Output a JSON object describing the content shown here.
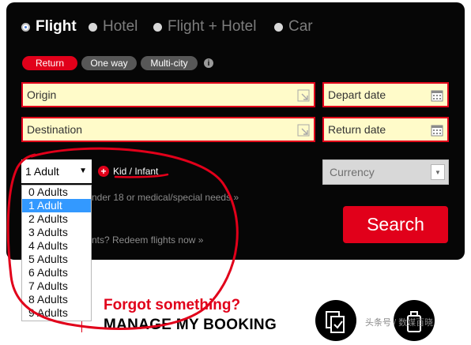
{
  "product_types": [
    {
      "label": "Flight",
      "selected": true
    },
    {
      "label": "Hotel",
      "selected": false
    },
    {
      "label": "Flight + Hotel",
      "selected": false
    },
    {
      "label": "Car",
      "selected": false
    }
  ],
  "trip_types": [
    {
      "label": "Return",
      "selected": true
    },
    {
      "label": "One way",
      "selected": false
    },
    {
      "label": "Multi-city",
      "selected": false
    }
  ],
  "trip_info_icon": "info-icon",
  "fields": {
    "origin_placeholder": "Origin",
    "destination_placeholder": "Destination",
    "depart_placeholder": "Depart date",
    "return_placeholder": "Return date"
  },
  "passengers": {
    "selected": "1 Adult",
    "options": [
      "0 Adults",
      "1 Adult",
      "2 Adults",
      "3 Adults",
      "4 Adults",
      "5 Adults",
      "6 Adults",
      "7 Adults",
      "8 Adults",
      "9 Adults"
    ],
    "highlighted_index": 1
  },
  "kid_label": "Kid / Infant",
  "currency_placeholder": "Currency",
  "note_under18": "nder 18 or medical/special needs »",
  "note_redeem": "nts? Redeem flights now »",
  "search_label": "Search",
  "banner": {
    "title": "Forgot something?",
    "subtitle": "MANAGE MY BOOKING"
  },
  "watermark": "头条号 / 数媒百晓",
  "colors": {
    "accent": "#e1001a",
    "panel": "#060606",
    "field_bg": "#fffbc9",
    "highlight": "#3399ff"
  }
}
